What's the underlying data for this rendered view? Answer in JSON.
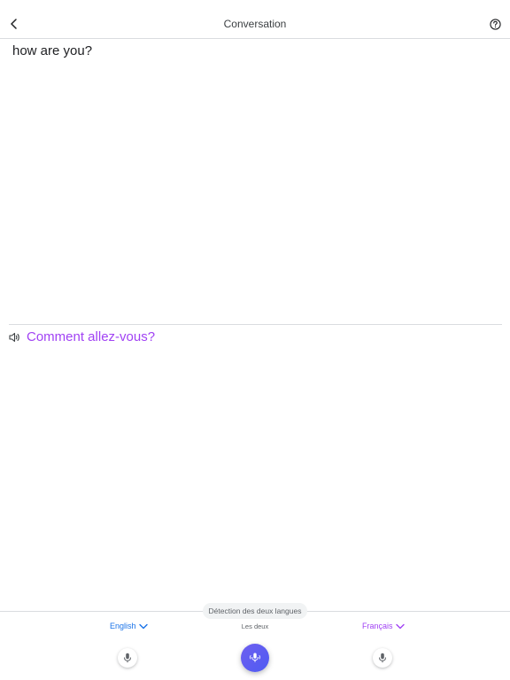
{
  "header": {
    "title": "Conversation",
    "back_icon": "back-arrow-icon",
    "help_icon": "help-icon"
  },
  "conversation": {
    "source_text": "how are you?",
    "translated_text": "Comment allez-vous?"
  },
  "bottom_bar": {
    "detect_chip": "Détection des deux langues",
    "left_language": "English",
    "right_language": "Français",
    "both_label": "Les deux"
  },
  "colors": {
    "source_language_accent": "#1a73e8",
    "target_language_accent": "#a142f4",
    "mic_center_gradient_start": "#6e5ff0",
    "mic_center_gradient_end": "#4e5bf2"
  }
}
